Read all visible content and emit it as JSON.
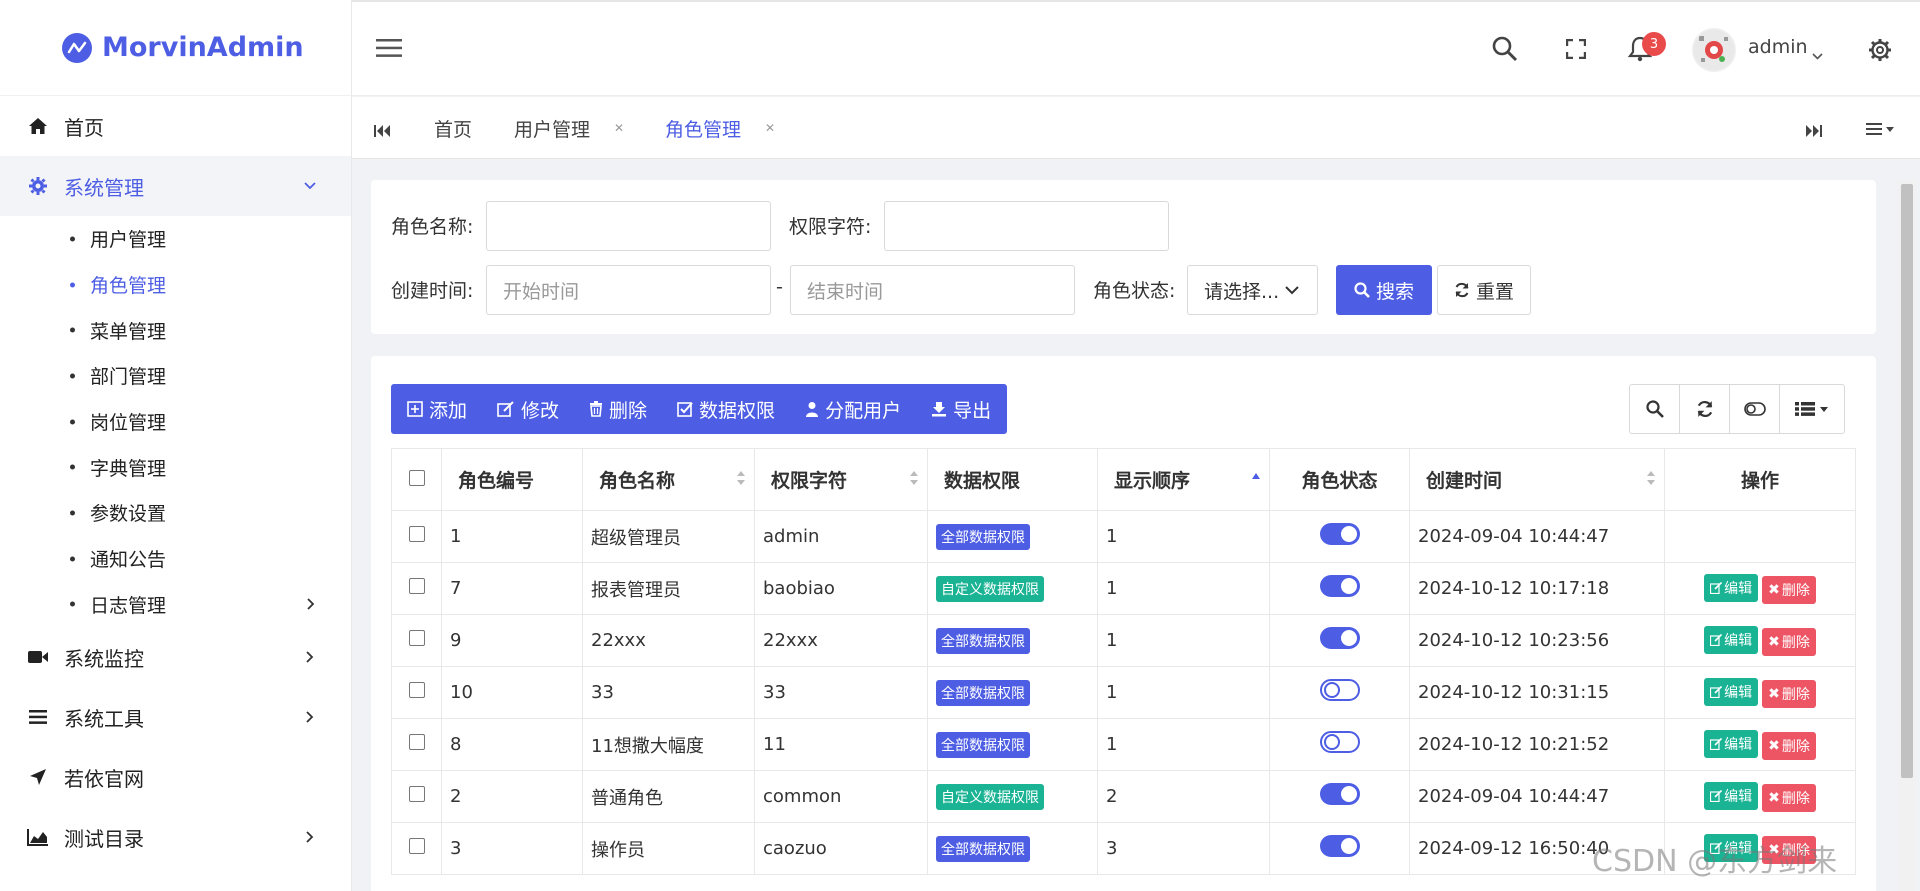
{
  "app": {
    "brand": "MorvinAdmin",
    "user": "admin",
    "notification_count": "3"
  },
  "sidebar": {
    "items": [
      {
        "label": "首页",
        "icon": "home-icon"
      },
      {
        "label": "系统管理",
        "icon": "gear-icon"
      }
    ],
    "sub_items": [
      "用户管理",
      "角色管理",
      "菜单管理",
      "部门管理",
      "岗位管理",
      "字典管理",
      "参数设置",
      "通知公告",
      "日志管理"
    ],
    "bottom_items": [
      {
        "label": "系统监控",
        "icon": "video-icon"
      },
      {
        "label": "系统工具",
        "icon": "list-icon"
      },
      {
        "label": "若依官网",
        "icon": "send-icon"
      },
      {
        "label": "测试目录",
        "icon": "chart-icon"
      }
    ]
  },
  "tabs": [
    "首页",
    "用户管理",
    "角色管理"
  ],
  "search": {
    "role_name_label": "角色名称:",
    "perm_label": "权限字符:",
    "created_label": "创建时间:",
    "start_placeholder": "开始时间",
    "end_placeholder": "结束时间",
    "dash": "-",
    "status_label": "角色状态:",
    "status_value": "请选择...",
    "search_btn": "搜索",
    "reset_btn": "重置"
  },
  "toolbar": {
    "add": "添加",
    "edit": "修改",
    "delete": "删除",
    "data_perm": "数据权限",
    "assign": "分配用户",
    "export": "导出"
  },
  "table": {
    "headers": [
      "角色编号",
      "角色名称",
      "权限字符",
      "数据权限",
      "显示顺序",
      "角色状态",
      "创建时间",
      "操作"
    ],
    "edit_label": "编辑",
    "delete_label": "删除",
    "rows": [
      {
        "id": "1",
        "name": "超级管理员",
        "key": "admin",
        "scope": "全部数据权限",
        "scope_color": "#4e5ee4",
        "order": "1",
        "status": "on",
        "created": "2024-09-04 10:44:47",
        "ops": false
      },
      {
        "id": "7",
        "name": "报表管理员",
        "key": "baobiao",
        "scope": "自定义数据权限",
        "scope_color": "#1ab394",
        "order": "1",
        "status": "on",
        "created": "2024-10-12 10:17:18",
        "ops": true
      },
      {
        "id": "9",
        "name": "22xxx",
        "key": "22xxx",
        "scope": "全部数据权限",
        "scope_color": "#4e5ee4",
        "order": "1",
        "status": "on",
        "created": "2024-10-12 10:23:56",
        "ops": true
      },
      {
        "id": "10",
        "name": "33",
        "key": "33",
        "scope": "全部数据权限",
        "scope_color": "#4e5ee4",
        "order": "1",
        "status": "off",
        "created": "2024-10-12 10:31:15",
        "ops": true
      },
      {
        "id": "8",
        "name": "11想撒大幅度",
        "key": "11",
        "scope": "全部数据权限",
        "scope_color": "#4e5ee4",
        "order": "1",
        "status": "off",
        "created": "2024-10-12 10:21:52",
        "ops": true
      },
      {
        "id": "2",
        "name": "普通角色",
        "key": "common",
        "scope": "自定义数据权限",
        "scope_color": "#1ab394",
        "order": "2",
        "status": "on",
        "created": "2024-09-04 10:44:47",
        "ops": true
      },
      {
        "id": "3",
        "name": "操作员",
        "key": "caozuo",
        "scope": "全部数据权限",
        "scope_color": "#4e5ee4",
        "order": "3",
        "status": "on",
        "created": "2024-09-12 16:50:40",
        "ops": true
      }
    ]
  },
  "watermark": "CSDN @东方剑来"
}
